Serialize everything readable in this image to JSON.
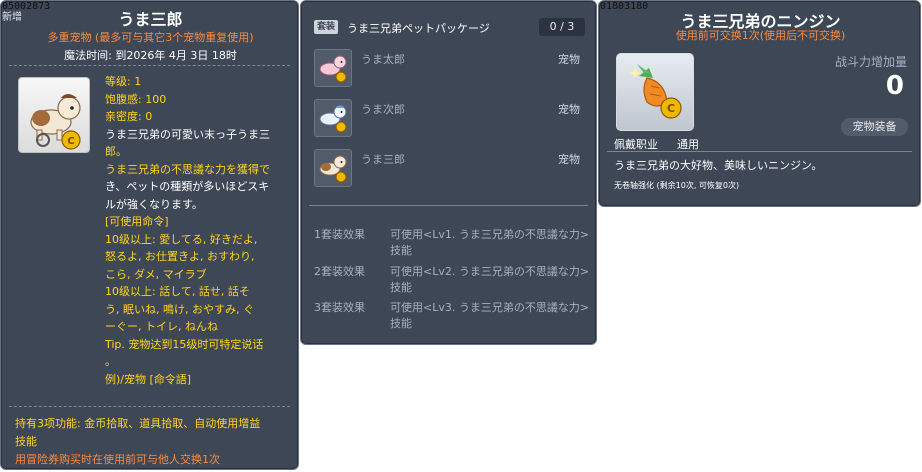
{
  "panel1": {
    "item_id": "05002873",
    "tag": "新增",
    "title": "うま三郎",
    "subtitle": "多重宠物 (最多可与其它3个宠物重复使用)",
    "magic_time": "魔法时间: 到2026年 4月 3日 18时",
    "stats": [
      "等级: 1",
      "饱腹感: 100",
      "亲密度: 0"
    ],
    "desc_lines": [
      "うま三兄弟の可愛い末っ子うま三",
      "郎。",
      "うま三兄弟の不思議な力を獲得でき、ペットの種類が多いほどスキ",
      "ルが強くなります。"
    ],
    "desc_line3a": "うま三兄弟の不思議な力を獲得で",
    "desc_line3b": "き、ペットの種類が多いほどスキ",
    "desc_line4": "ルが強くなります。",
    "cmd_header": "[可使用命令]",
    "cmd_lines": [
      "10级以上:  愛してる, 好きだよ,",
      "怒るよ, お仕置きよ, おすわり,",
      "こら, ダメ, マイラブ",
      "10级以上:  話して, 話せ, 話そ",
      "う, 眠いね, 鳴け, おやすみ, ぐ",
      "ーぐー, トイレ, ねんね",
      "Tip. 宠物达到15级时可特定说话",
      "。",
      "例)/宠物 [命令語]"
    ],
    "func_line1": "持有3项功能: 金币拾取、道具拾取、自动使用增益",
    "func_line2": "技能",
    "trade_note": "用冒险券购买时在使用前可与他人交换1次"
  },
  "panel2": {
    "badge": "套装",
    "set_title": "うま三兄弟ペットパッケージ",
    "count": "0 / 3",
    "pets": [
      {
        "name": "うま太郎",
        "type": "宠物"
      },
      {
        "name": "うま次郎",
        "type": "宠物"
      },
      {
        "name": "うま三郎",
        "type": "宠物"
      }
    ],
    "effects": [
      {
        "label": "1套装效果",
        "line1": "可使用<Lv1. うま三兄弟の不思議な力>",
        "line2": "技能"
      },
      {
        "label": "2套装效果",
        "line1": "可使用<Lv2. うま三兄弟の不思議な力>",
        "line2": "技能"
      },
      {
        "label": "3套装效果",
        "line1": "可使用<Lv3. うま三兄弟の不思議な力>",
        "line2": "技能"
      }
    ]
  },
  "panel3": {
    "item_id": "01803180",
    "title": "うま三兄弟のニンジン",
    "trade_rule": "使用前可交换1次(使用后不可交换)",
    "power_label": "战斗力增加量",
    "power_value": "0",
    "equip_button": "宠物装备",
    "job_label": "佩戴职业",
    "job_value": "通用",
    "desc": "うま三兄弟の大好物、美味しいニンジン。",
    "small_note": "无卷轴强化 (剩余10次, 可恢复0次)"
  },
  "colors": {
    "panel_bg": "#3e4756",
    "yellow": "#ffd51a",
    "orange": "#ff8a3a",
    "gray": "#a8b0bc"
  }
}
